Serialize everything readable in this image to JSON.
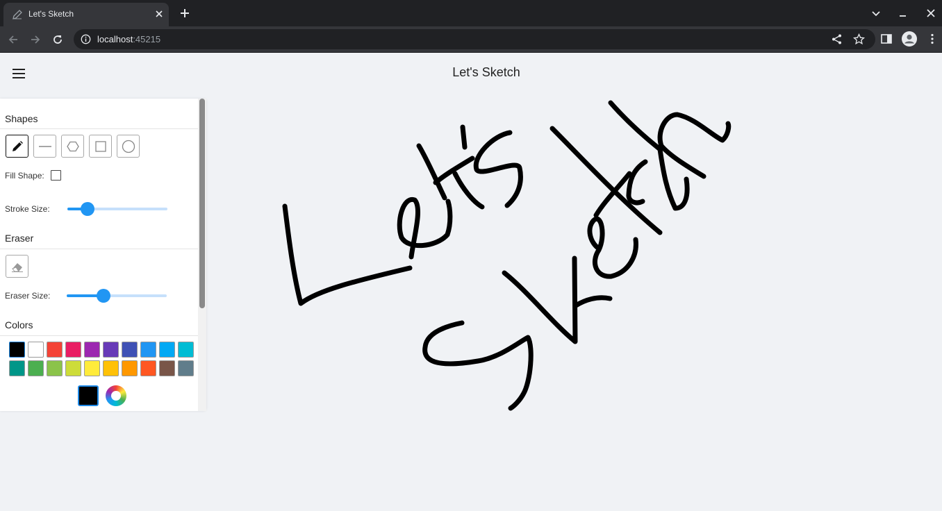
{
  "browser": {
    "tab_title": "Let's Sketch",
    "url_host": "localhost",
    "url_port": ":45215"
  },
  "app": {
    "title": "Let's Sketch"
  },
  "panel": {
    "shapes_title": "Shapes",
    "shape_tools": [
      {
        "name": "pencil-icon",
        "active": true
      },
      {
        "name": "line-icon",
        "active": false
      },
      {
        "name": "polygon-icon",
        "active": false
      },
      {
        "name": "rectangle-icon",
        "active": false
      },
      {
        "name": "circle-icon",
        "active": false
      }
    ],
    "fill_shape_label": "Fill Shape:",
    "fill_shape_checked": false,
    "stroke_size_label": "Stroke Size:",
    "stroke_size_fraction": 0.2,
    "eraser_title": "Eraser",
    "eraser_size_label": "Eraser Size:",
    "eraser_size_fraction": 0.37,
    "colors_title": "Colors",
    "palette": [
      "#000000",
      "#ffffff",
      "#f44336",
      "#e91e63",
      "#9c27b0",
      "#673ab7",
      "#3f51b5",
      "#2196f3",
      "#03a9f4",
      "#00bcd4",
      "#009688",
      "#4caf50",
      "#8bc34a",
      "#cddc39",
      "#ffeb3b",
      "#ffc107",
      "#ff9800",
      "#ff5722",
      "#795548",
      "#607d8b"
    ],
    "selected_color": "#000000"
  }
}
